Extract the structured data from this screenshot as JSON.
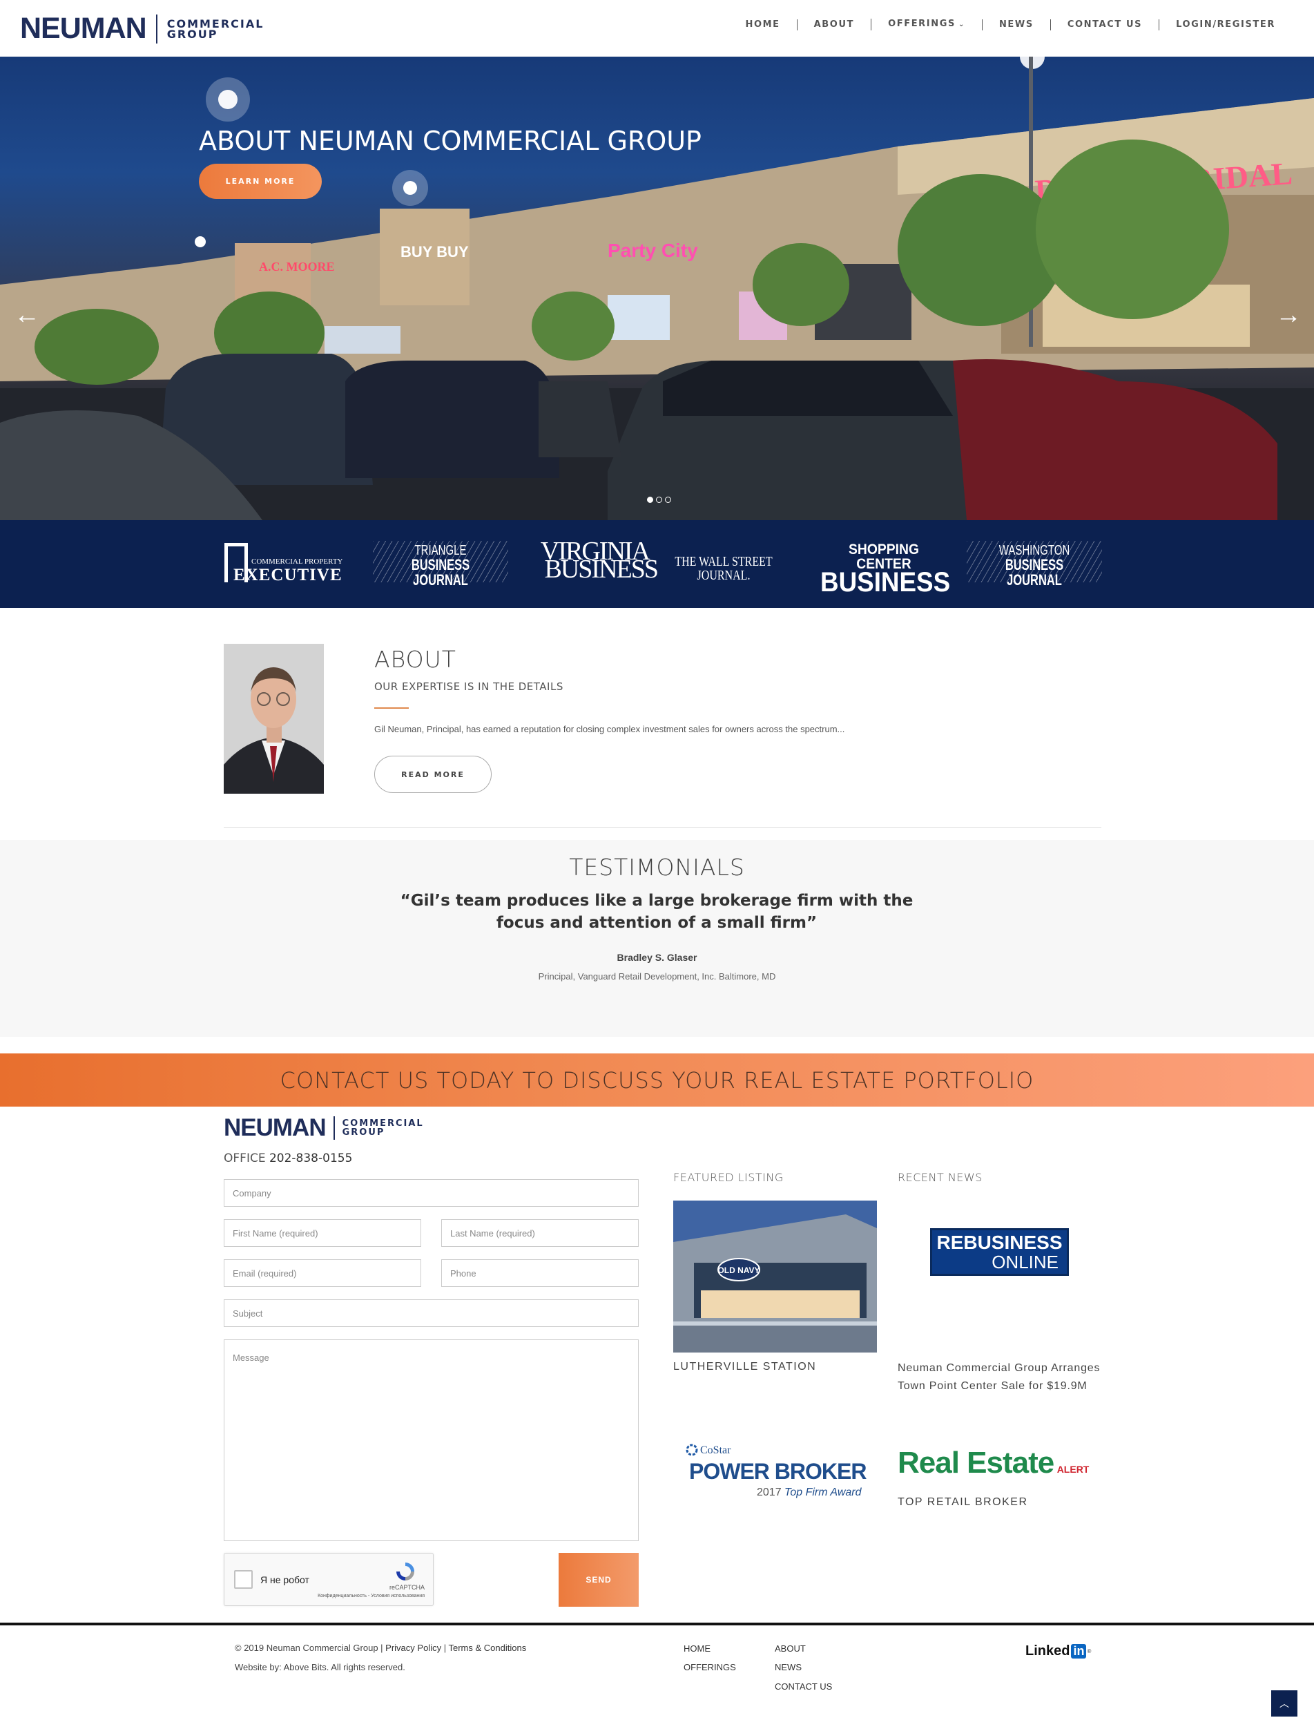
{
  "header": {
    "logo_main": "NEUMAN",
    "logo_sub_1": "COMMERCIAL",
    "logo_sub_2": "GROUP",
    "nav": [
      {
        "label": "HOME"
      },
      {
        "label": "ABOUT"
      },
      {
        "label": "OFFERINGS"
      },
      {
        "label": "NEWS"
      },
      {
        "label": "CONTACT US"
      },
      {
        "label": "LOGIN/REGISTER"
      }
    ]
  },
  "hero": {
    "title": "ABOUT NEUMAN COMMERCIAL GROUP",
    "button": "LEARN MORE",
    "store_signs": [
      "A.C. MOORE",
      "DAVID'S BRIDAL",
      "Party City",
      "BUY BUY"
    ],
    "slides_total": 3,
    "active_slide": 1,
    "prev_icon": "arrow-left-icon",
    "next_icon": "arrow-right-icon"
  },
  "press": {
    "cpe_1": "COMMERCIAL PROPERTY",
    "cpe_2": "EXECUTIVE",
    "tbj_1": "TRIANGLE",
    "tbj_2": "BUSINESS JOURNAL",
    "vb_1": "VIRGINIA",
    "vb_2": "BUSINESS",
    "wsj": "THE WALL STREET JOURNAL.",
    "scb_1": "SHOPPING CENTER",
    "scb_2": "BUSINESS",
    "wbj_1": "WASHINGTON",
    "wbj_2": "BUSINESS JOURNAL"
  },
  "about": {
    "title": "ABOUT",
    "subtitle": "OUR EXPERTISE IS IN THE DETAILS",
    "text": "Gil Neuman, Principal, has earned a reputation for closing complex investment sales for owners across the spectrum...",
    "button": "READ MORE"
  },
  "testimonials": {
    "title": "TESTIMONIALS",
    "quote": "“Gil’s team produces like a large brokerage firm with the focus and attention of a small firm”",
    "author": "Bradley S. Glaser",
    "role": "Principal, Vanguard Retail Development, Inc. Baltimore, MD"
  },
  "banner": {
    "text": "CONTACT US TODAY TO DISCUSS YOUR REAL ESTATE PORTFOLIO"
  },
  "contact": {
    "office_label": "OFFICE",
    "office_phone": "202-838-0155",
    "placeholders": {
      "company": "Company",
      "first_name": "First Name (required)",
      "last_name": "Last Name (required)",
      "email": "Email (required)",
      "phone": "Phone",
      "subject": "Subject",
      "message": "Message"
    },
    "captcha_label": "Я не робот",
    "captcha_brand": "reCAPTCHA",
    "captcha_terms": "Конфиденциальность - Условия использования",
    "send": "SEND"
  },
  "featured": {
    "title": "FEATURED LISTING",
    "store_sign": "OLD NAVY",
    "caption": "LUTHERVILLE STATION"
  },
  "costar": {
    "brand": "CoStar",
    "line_1": "POWER BROKER",
    "line_2_a": "2017",
    "line_2_b": "Top Firm Award"
  },
  "news": {
    "title": "RECENT NEWS",
    "logo_1": "REBUSINESS",
    "logo_2": "ONLINE",
    "caption": "Neuman Commercial Group Arranges Town Point Center Sale for $19.9M",
    "re_alert_main": "Real Estate",
    "re_alert_sub": "ALERT",
    "re_caption": "TOP RETAIL BROKER"
  },
  "footer": {
    "copyright": "© 2019 Neuman Commercial Group |",
    "privacy": "Privacy Policy",
    "sep": "|",
    "terms": "Terms & Conditions",
    "website_by": "Website by: Above Bits. All rights reserved.",
    "links_col1": [
      "HOME",
      "OFFERINGS"
    ],
    "links_col2": [
      "ABOUT",
      "NEWS",
      "CONTACT US"
    ],
    "linkedin_a": "Linked",
    "linkedin_b": "in",
    "linkedin_reg": "®",
    "to_top_icon": "chevron-up-icon"
  },
  "colors": {
    "navy": "#1f2d5a",
    "press_bg": "#0c2150",
    "accent_orange": "#ec7a3c",
    "linkedin_blue": "#0a66c2"
  }
}
